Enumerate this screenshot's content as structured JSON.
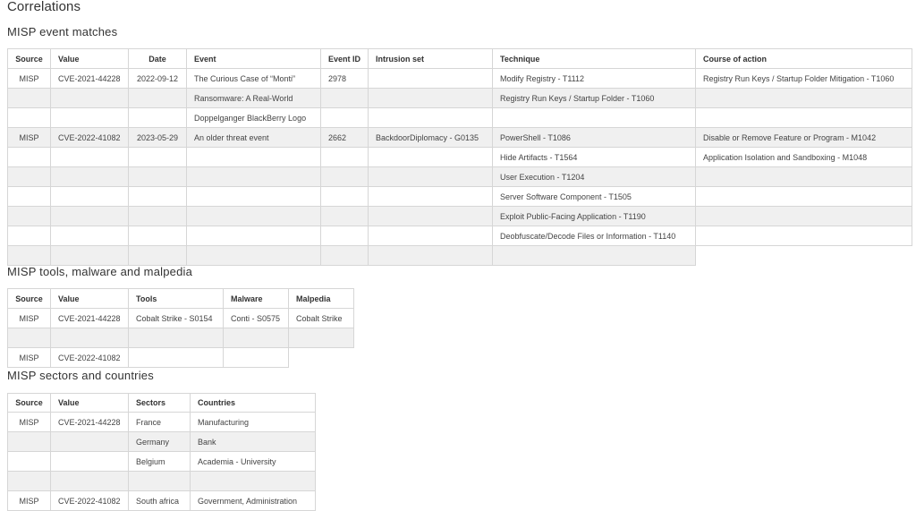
{
  "page": {
    "title": "Correlations"
  },
  "events": {
    "heading": "MISP event matches",
    "columns": [
      "Source",
      "Value",
      "Date",
      "Event",
      "Event ID",
      "Intrusion set",
      "Technique",
      "Course of action"
    ],
    "rows": [
      [
        "MISP",
        "CVE-2021-44228",
        "2022-09-12",
        "The Curious Case of “Monti”",
        "2978",
        "",
        "Modify Registry - T1112",
        "Registry Run Keys / Startup Folder Mitigation - T1060"
      ],
      [
        "",
        "",
        "",
        "Ransomware: A Real-World",
        "",
        "",
        "Registry Run Keys / Startup Folder - T1060",
        ""
      ],
      [
        "",
        "",
        "",
        "Doppelganger BlackBerry Logo",
        "",
        "",
        "",
        ""
      ],
      [
        "MISP",
        "CVE-2022-41082",
        "2023-05-29",
        "An older threat event",
        "2662",
        "BackdoorDiplomacy - G0135",
        "PowerShell - T1086",
        "Disable or Remove Feature or Program - M1042"
      ],
      [
        "",
        "",
        "",
        "",
        "",
        "",
        "Hide Artifacts - T1564",
        "Application Isolation and Sandboxing - M1048"
      ],
      [
        "",
        "",
        "",
        "",
        "",
        "",
        "User Execution - T1204",
        ""
      ],
      [
        "",
        "",
        "",
        "",
        "",
        "",
        "Server Software Component - T1505",
        ""
      ],
      [
        "",
        "",
        "",
        "",
        "",
        "",
        "Exploit Public-Facing Application - T1190",
        ""
      ],
      [
        "",
        "",
        "",
        "",
        "",
        "",
        "Deobfuscate/Decode Files or Information - T1140",
        ""
      ]
    ]
  },
  "tools": {
    "heading": "MISP tools, malware and malpedia",
    "columns": [
      "Source",
      "Value",
      "Tools",
      "Malware",
      "Malpedia"
    ],
    "rows": [
      [
        "MISP",
        "CVE-2021-44228",
        "Cobalt Strike - S0154",
        "Conti - S0575",
        "Cobalt Strike"
      ],
      [
        "MISP",
        "CVE-2022-41082",
        "",
        "",
        ""
      ]
    ]
  },
  "sectors": {
    "heading": "MISP sectors and countries",
    "columns": [
      "Source",
      "Value",
      "Sectors",
      "Countries"
    ],
    "rows": [
      [
        "MISP",
        "CVE-2021-44228",
        "France",
        "Manufacturing"
      ],
      [
        "",
        "",
        "Germany",
        "Bank"
      ],
      [
        "",
        "",
        "Belgium",
        "Academia - University"
      ],
      [
        "MISP",
        "CVE-2022-41082",
        "South africa",
        "Government, Administration"
      ]
    ]
  }
}
